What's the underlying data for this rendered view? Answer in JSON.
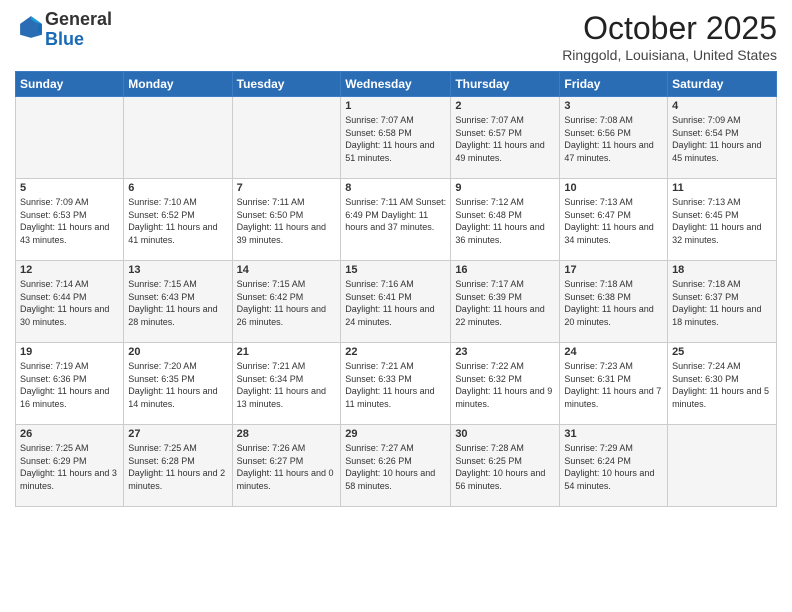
{
  "header": {
    "logo_general": "General",
    "logo_blue": "Blue",
    "month_title": "October 2025",
    "location": "Ringgold, Louisiana, United States"
  },
  "weekdays": [
    "Sunday",
    "Monday",
    "Tuesday",
    "Wednesday",
    "Thursday",
    "Friday",
    "Saturday"
  ],
  "weeks": [
    [
      {
        "day": "",
        "info": ""
      },
      {
        "day": "",
        "info": ""
      },
      {
        "day": "",
        "info": ""
      },
      {
        "day": "1",
        "info": "Sunrise: 7:07 AM\nSunset: 6:58 PM\nDaylight: 11 hours\nand 51 minutes."
      },
      {
        "day": "2",
        "info": "Sunrise: 7:07 AM\nSunset: 6:57 PM\nDaylight: 11 hours\nand 49 minutes."
      },
      {
        "day": "3",
        "info": "Sunrise: 7:08 AM\nSunset: 6:56 PM\nDaylight: 11 hours\nand 47 minutes."
      },
      {
        "day": "4",
        "info": "Sunrise: 7:09 AM\nSunset: 6:54 PM\nDaylight: 11 hours\nand 45 minutes."
      }
    ],
    [
      {
        "day": "5",
        "info": "Sunrise: 7:09 AM\nSunset: 6:53 PM\nDaylight: 11 hours\nand 43 minutes."
      },
      {
        "day": "6",
        "info": "Sunrise: 7:10 AM\nSunset: 6:52 PM\nDaylight: 11 hours\nand 41 minutes."
      },
      {
        "day": "7",
        "info": "Sunrise: 7:11 AM\nSunset: 6:50 PM\nDaylight: 11 hours\nand 39 minutes."
      },
      {
        "day": "8",
        "info": "Sunrise: 7:11 AM\nSunset: 6:49 PM\nDaylight: 11 hours\nand 37 minutes."
      },
      {
        "day": "9",
        "info": "Sunrise: 7:12 AM\nSunset: 6:48 PM\nDaylight: 11 hours\nand 36 minutes."
      },
      {
        "day": "10",
        "info": "Sunrise: 7:13 AM\nSunset: 6:47 PM\nDaylight: 11 hours\nand 34 minutes."
      },
      {
        "day": "11",
        "info": "Sunrise: 7:13 AM\nSunset: 6:45 PM\nDaylight: 11 hours\nand 32 minutes."
      }
    ],
    [
      {
        "day": "12",
        "info": "Sunrise: 7:14 AM\nSunset: 6:44 PM\nDaylight: 11 hours\nand 30 minutes."
      },
      {
        "day": "13",
        "info": "Sunrise: 7:15 AM\nSunset: 6:43 PM\nDaylight: 11 hours\nand 28 minutes."
      },
      {
        "day": "14",
        "info": "Sunrise: 7:15 AM\nSunset: 6:42 PM\nDaylight: 11 hours\nand 26 minutes."
      },
      {
        "day": "15",
        "info": "Sunrise: 7:16 AM\nSunset: 6:41 PM\nDaylight: 11 hours\nand 24 minutes."
      },
      {
        "day": "16",
        "info": "Sunrise: 7:17 AM\nSunset: 6:39 PM\nDaylight: 11 hours\nand 22 minutes."
      },
      {
        "day": "17",
        "info": "Sunrise: 7:18 AM\nSunset: 6:38 PM\nDaylight: 11 hours\nand 20 minutes."
      },
      {
        "day": "18",
        "info": "Sunrise: 7:18 AM\nSunset: 6:37 PM\nDaylight: 11 hours\nand 18 minutes."
      }
    ],
    [
      {
        "day": "19",
        "info": "Sunrise: 7:19 AM\nSunset: 6:36 PM\nDaylight: 11 hours\nand 16 minutes."
      },
      {
        "day": "20",
        "info": "Sunrise: 7:20 AM\nSunset: 6:35 PM\nDaylight: 11 hours\nand 14 minutes."
      },
      {
        "day": "21",
        "info": "Sunrise: 7:21 AM\nSunset: 6:34 PM\nDaylight: 11 hours\nand 13 minutes."
      },
      {
        "day": "22",
        "info": "Sunrise: 7:21 AM\nSunset: 6:33 PM\nDaylight: 11 hours\nand 11 minutes."
      },
      {
        "day": "23",
        "info": "Sunrise: 7:22 AM\nSunset: 6:32 PM\nDaylight: 11 hours\nand 9 minutes."
      },
      {
        "day": "24",
        "info": "Sunrise: 7:23 AM\nSunset: 6:31 PM\nDaylight: 11 hours\nand 7 minutes."
      },
      {
        "day": "25",
        "info": "Sunrise: 7:24 AM\nSunset: 6:30 PM\nDaylight: 11 hours\nand 5 minutes."
      }
    ],
    [
      {
        "day": "26",
        "info": "Sunrise: 7:25 AM\nSunset: 6:29 PM\nDaylight: 11 hours\nand 3 minutes."
      },
      {
        "day": "27",
        "info": "Sunrise: 7:25 AM\nSunset: 6:28 PM\nDaylight: 11 hours\nand 2 minutes."
      },
      {
        "day": "28",
        "info": "Sunrise: 7:26 AM\nSunset: 6:27 PM\nDaylight: 11 hours\nand 0 minutes."
      },
      {
        "day": "29",
        "info": "Sunrise: 7:27 AM\nSunset: 6:26 PM\nDaylight: 10 hours\nand 58 minutes."
      },
      {
        "day": "30",
        "info": "Sunrise: 7:28 AM\nSunset: 6:25 PM\nDaylight: 10 hours\nand 56 minutes."
      },
      {
        "day": "31",
        "info": "Sunrise: 7:29 AM\nSunset: 6:24 PM\nDaylight: 10 hours\nand 54 minutes."
      },
      {
        "day": "",
        "info": ""
      }
    ]
  ]
}
